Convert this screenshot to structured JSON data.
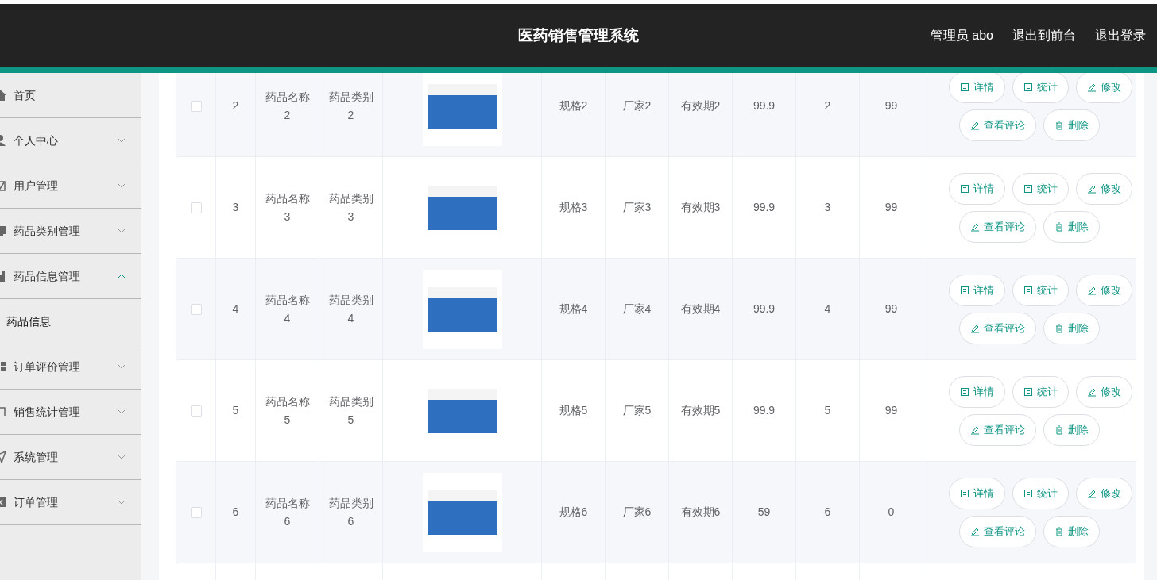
{
  "header": {
    "title": "医药销售管理系统",
    "links": [
      {
        "label": "管理员 abo"
      },
      {
        "label": "退出到前台"
      },
      {
        "label": "退出登录"
      }
    ]
  },
  "sidebar": {
    "items": [
      {
        "label": "首页",
        "kind": "link"
      },
      {
        "label": "个人中心",
        "kind": "menu",
        "expanded": false
      },
      {
        "label": "用户管理",
        "kind": "menu",
        "expanded": false
      },
      {
        "label": "药品类别管理",
        "kind": "menu",
        "expanded": false
      },
      {
        "label": "药品信息管理",
        "kind": "menu",
        "expanded": true,
        "children": [
          {
            "label": "药品信息",
            "selected": true
          }
        ]
      },
      {
        "label": "订单评价管理",
        "kind": "menu",
        "expanded": false
      },
      {
        "label": "销售统计管理",
        "kind": "menu",
        "expanded": false
      },
      {
        "label": "系统管理",
        "kind": "menu",
        "expanded": false
      },
      {
        "label": "订单管理",
        "kind": "menu",
        "expanded": false
      }
    ]
  },
  "table": {
    "rows": [
      {
        "checked": false,
        "cells": [
          "2",
          "药品名称2",
          "药品类别2",
          "规格2",
          "厂家2",
          "有效期2",
          "99.9",
          "2",
          "99"
        ],
        "actions": [
          "详情",
          "统计",
          "修改",
          "查看评论",
          "删除"
        ]
      },
      {
        "checked": false,
        "cells": [
          "3",
          "药品名称3",
          "药品类别3",
          "规格3",
          "厂家3",
          "有效期3",
          "99.9",
          "3",
          "99"
        ],
        "actions": [
          "详情",
          "统计",
          "修改",
          "查看评论",
          "删除"
        ]
      },
      {
        "checked": false,
        "cells": [
          "4",
          "药品名称4",
          "药品类别4",
          "规格4",
          "厂家4",
          "有效期4",
          "99.9",
          "4",
          "99"
        ],
        "actions": [
          "详情",
          "统计",
          "修改",
          "查看评论",
          "删除"
        ]
      },
      {
        "checked": false,
        "cells": [
          "5",
          "药品名称5",
          "药品类别5",
          "规格5",
          "厂家5",
          "有效期5",
          "99.9",
          "5",
          "99"
        ],
        "actions": [
          "详情",
          "统计",
          "修改",
          "查看评论",
          "删除"
        ]
      },
      {
        "checked": false,
        "cells": [
          "6",
          "药品名称6",
          "药品类别6",
          "规格6",
          "厂家6",
          "有效期6",
          "59",
          "6",
          "0"
        ],
        "actions": [
          "详情",
          "统计",
          "修改",
          "查看评论",
          "删除"
        ]
      }
    ]
  }
}
